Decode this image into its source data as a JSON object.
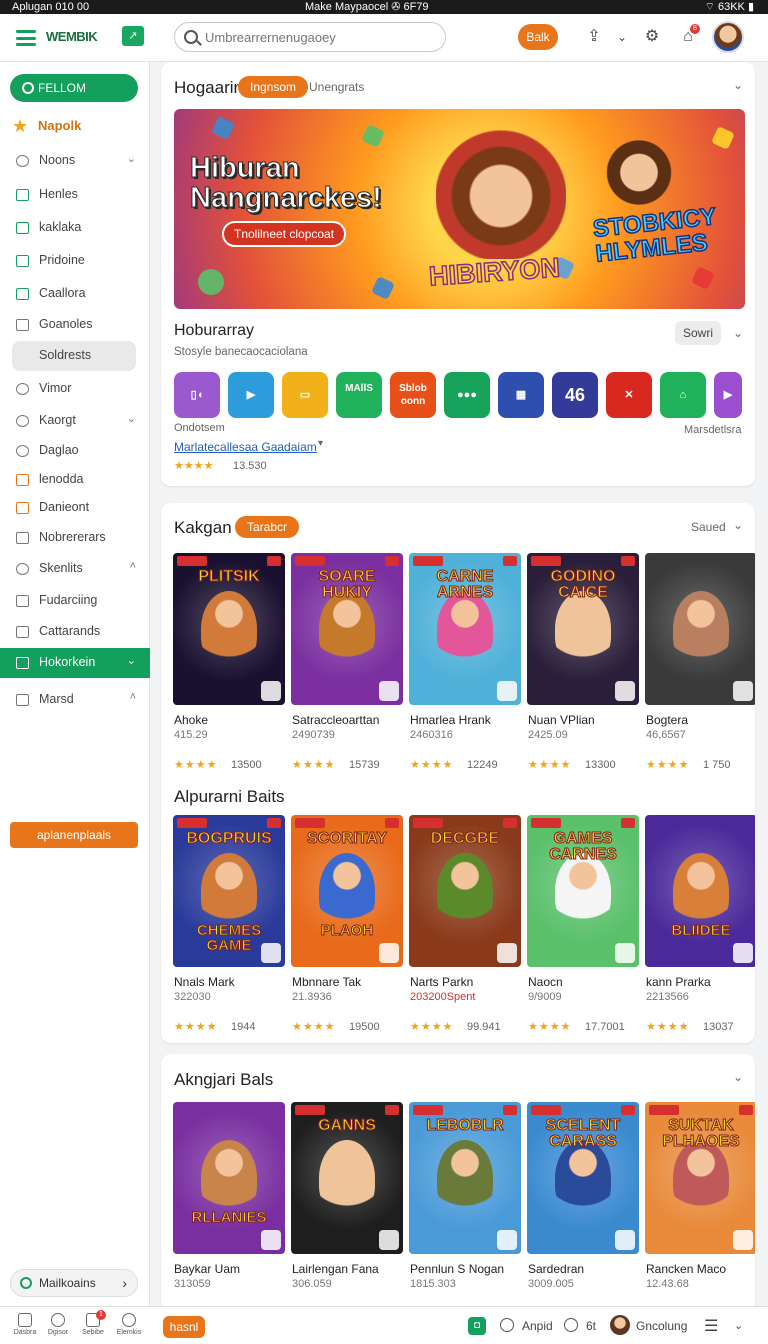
{
  "status_bar": {
    "left": "Aplugan 010 00",
    "center": "Make Maypaocel ✇ 6F79",
    "right": "⌔ 63KK ▮"
  },
  "topbar": {
    "logo": "WEMBIK",
    "search_placeholder": "Umbrearrernenugaoey",
    "balk_label": "Balk",
    "notif_count": "8"
  },
  "sidebar": {
    "pill_label": "FELLOM",
    "highlight_label": "Napolk",
    "items": [
      {
        "label": "Noons",
        "chev": "⌄"
      },
      {
        "label": "Henles",
        "chev": ""
      },
      {
        "label": "kaklaka",
        "chev": ""
      },
      {
        "label": "Pridoine",
        "chev": ""
      },
      {
        "label": "Caallora",
        "chev": ""
      },
      {
        "label": "Goanoles",
        "chev": ""
      },
      {
        "label": "Soldrests",
        "chev": ""
      },
      {
        "label": "Vimor",
        "chev": ""
      },
      {
        "label": "Kaorgt",
        "chev": "⌄"
      },
      {
        "label": "Daglao",
        "chev": ""
      },
      {
        "label": "lenodda",
        "chev": ""
      },
      {
        "label": "Danieont",
        "chev": ""
      },
      {
        "label": "Nobrererars",
        "chev": ""
      },
      {
        "label": "Skenlits",
        "chev": "˄"
      },
      {
        "label": "Fudarciing",
        "chev": ""
      },
      {
        "label": "Cattarands",
        "chev": ""
      },
      {
        "label": "Hokorkein",
        "chev": "⌄"
      },
      {
        "label": "Marsd",
        "chev": "˄"
      }
    ],
    "cta_label": "aplanenplaals",
    "bottom_label": "Mailkoains"
  },
  "hero_card": {
    "title": "Hogaarin",
    "tag": "Ingnsom",
    "subtitle": "Unengrats",
    "banner_title": "Hiburan Nangnarckes!",
    "banner_button": "Tnolilneet clopcoat",
    "banner_logo1": "HIBIRYON",
    "banner_logo2": "STOBKICY HLYMLES",
    "section_title": "Hoburarray",
    "section_sub": "Stosyle banecaocaciolana",
    "sort_label": "Sowri",
    "apps": [
      {
        "label": "▯◖",
        "color": "#9b59d0"
      },
      {
        "label": "▶",
        "color": "#2d9cdb"
      },
      {
        "label": "▭",
        "color": "#f2b01b"
      },
      {
        "label": "MAllS",
        "color": "#20b25a"
      },
      {
        "label": "Sblob oonn",
        "color": "#e8501a"
      },
      {
        "label": "●●●",
        "color": "#17a35a"
      },
      {
        "label": "▦",
        "color": "#2f4fb0"
      },
      {
        "label": "46",
        "color": "#333a9a"
      },
      {
        "label": "✕",
        "color": "#d9281e"
      },
      {
        "label": "⌂",
        "color": "#20b25a"
      },
      {
        "label": "▶",
        "color": "#9b4fd0"
      }
    ],
    "footer_label": "Ondotsem",
    "footer_link": "Marlatecallesaa Gaadaiam",
    "footer_right": "Marsdetlsra",
    "footer_stars": "★★★★",
    "footer_count": "13.530"
  },
  "section_kakgan": {
    "title": "Kakgan",
    "tag": "Tarabcr",
    "right": "Saued",
    "games": [
      {
        "name": "Ahoke",
        "meta": "415.29",
        "count": "13500",
        "title_art": "PLITSIK",
        "bg": "#1a1030",
        "char": "#d17a3a"
      },
      {
        "name": "Satraccleoarttan",
        "meta": "2490739",
        "count": "15739",
        "title_art": "SOARE HUKIY",
        "bg": "#7b2fa0",
        "char": "#c47a2a"
      },
      {
        "name": "Hmarlea Hrank",
        "meta": "2460316",
        "count": "12249",
        "title_art": "CARNE ARNES",
        "bg": "#4fb0d8",
        "char": "#e3569a"
      },
      {
        "name": "Nuan VPlian",
        "meta": "2425.09",
        "count": "13300",
        "title_art": "GODINO CAICE",
        "bg": "#2a1f3a",
        "char": "#f0c49a"
      },
      {
        "name": "Bogtera",
        "meta": "46,6567",
        "count": "1 750",
        "title_art": "",
        "bg": "#3a3a3a",
        "char": "#b88060"
      }
    ]
  },
  "section_alpurarni": {
    "title": "Alpurarni Baits",
    "games": [
      {
        "name": "Nnals Mark",
        "meta": "322030",
        "count": "1944",
        "meta_red": false,
        "title_art": "BOGPRUIS",
        "bottom_art": "CHEMES GAME",
        "bg": "#2a3a9a",
        "char": "#d17a3a"
      },
      {
        "name": "Mbnnare Tak",
        "meta": "21.3936",
        "count": "19500",
        "meta_red": false,
        "title_art": "SCORITAY",
        "bottom_art": "PLAOH",
        "bg": "#e86a1a",
        "char": "#3a6ad0"
      },
      {
        "name": "Narts Parkn",
        "meta": "203200Spent",
        "count": "99.941",
        "meta_red": true,
        "title_art": "DECGBE",
        "bottom_art": "",
        "bg": "#8a3a1a",
        "char": "#5a8a2a"
      },
      {
        "name": "Naocn",
        "meta": "9/9009",
        "count": "17.7001",
        "meta_red": false,
        "title_art": "GAMES CARNES",
        "bottom_art": "",
        "bg": "#5ac06a",
        "char": "#f5f5f5"
      },
      {
        "name": "kann Prarka",
        "meta": "2213566",
        "count": "13037",
        "meta_red": false,
        "title_art": "",
        "bottom_art": "BLIIDEE",
        "bg": "#4a2a9a",
        "char": "#d8803a"
      }
    ]
  },
  "section_akngjari": {
    "title": "Akngjari Bals",
    "games": [
      {
        "name": "Baykar Uam",
        "meta": "313059",
        "title_art": "",
        "bottom_art": "RLLANIES",
        "bg": "#7a2fa0",
        "char": "#c8844a"
      },
      {
        "name": "Lairlengan Fana",
        "meta": "306.059",
        "title_art": "GANNS",
        "bottom_art": "",
        "bg": "#1e1e1e",
        "char": "#f0c49a"
      },
      {
        "name": "Pennlun S Nogan",
        "meta": "1815.303",
        "title_art": "LEBOBLR",
        "bottom_art": "",
        "bg": "#4a9ad8",
        "char": "#6a7a3a"
      },
      {
        "name": "Sardedran",
        "meta": "3009.005",
        "title_art": "SCELENT CARASS",
        "bottom_art": "",
        "bg": "#3a8ad0",
        "char": "#2a4a9a"
      },
      {
        "name": "Rancken Maco",
        "meta": "12.43.68",
        "title_art": "SUKTAK PLHAOES",
        "bottom_art": "",
        "bg": "#e88a3a",
        "char": "#c05a5a"
      }
    ]
  },
  "bottom_bar": {
    "items": [
      "Dasbra",
      "Dgisor",
      "Sebibe",
      "Elemkis"
    ],
    "badge": "1",
    "button": "hasnl",
    "right_items": [
      "Anpid",
      "6t",
      "Gncolung"
    ]
  },
  "colors": {
    "green": "#12a05c",
    "orange": "#e8751a",
    "star": "#f2a21b"
  }
}
